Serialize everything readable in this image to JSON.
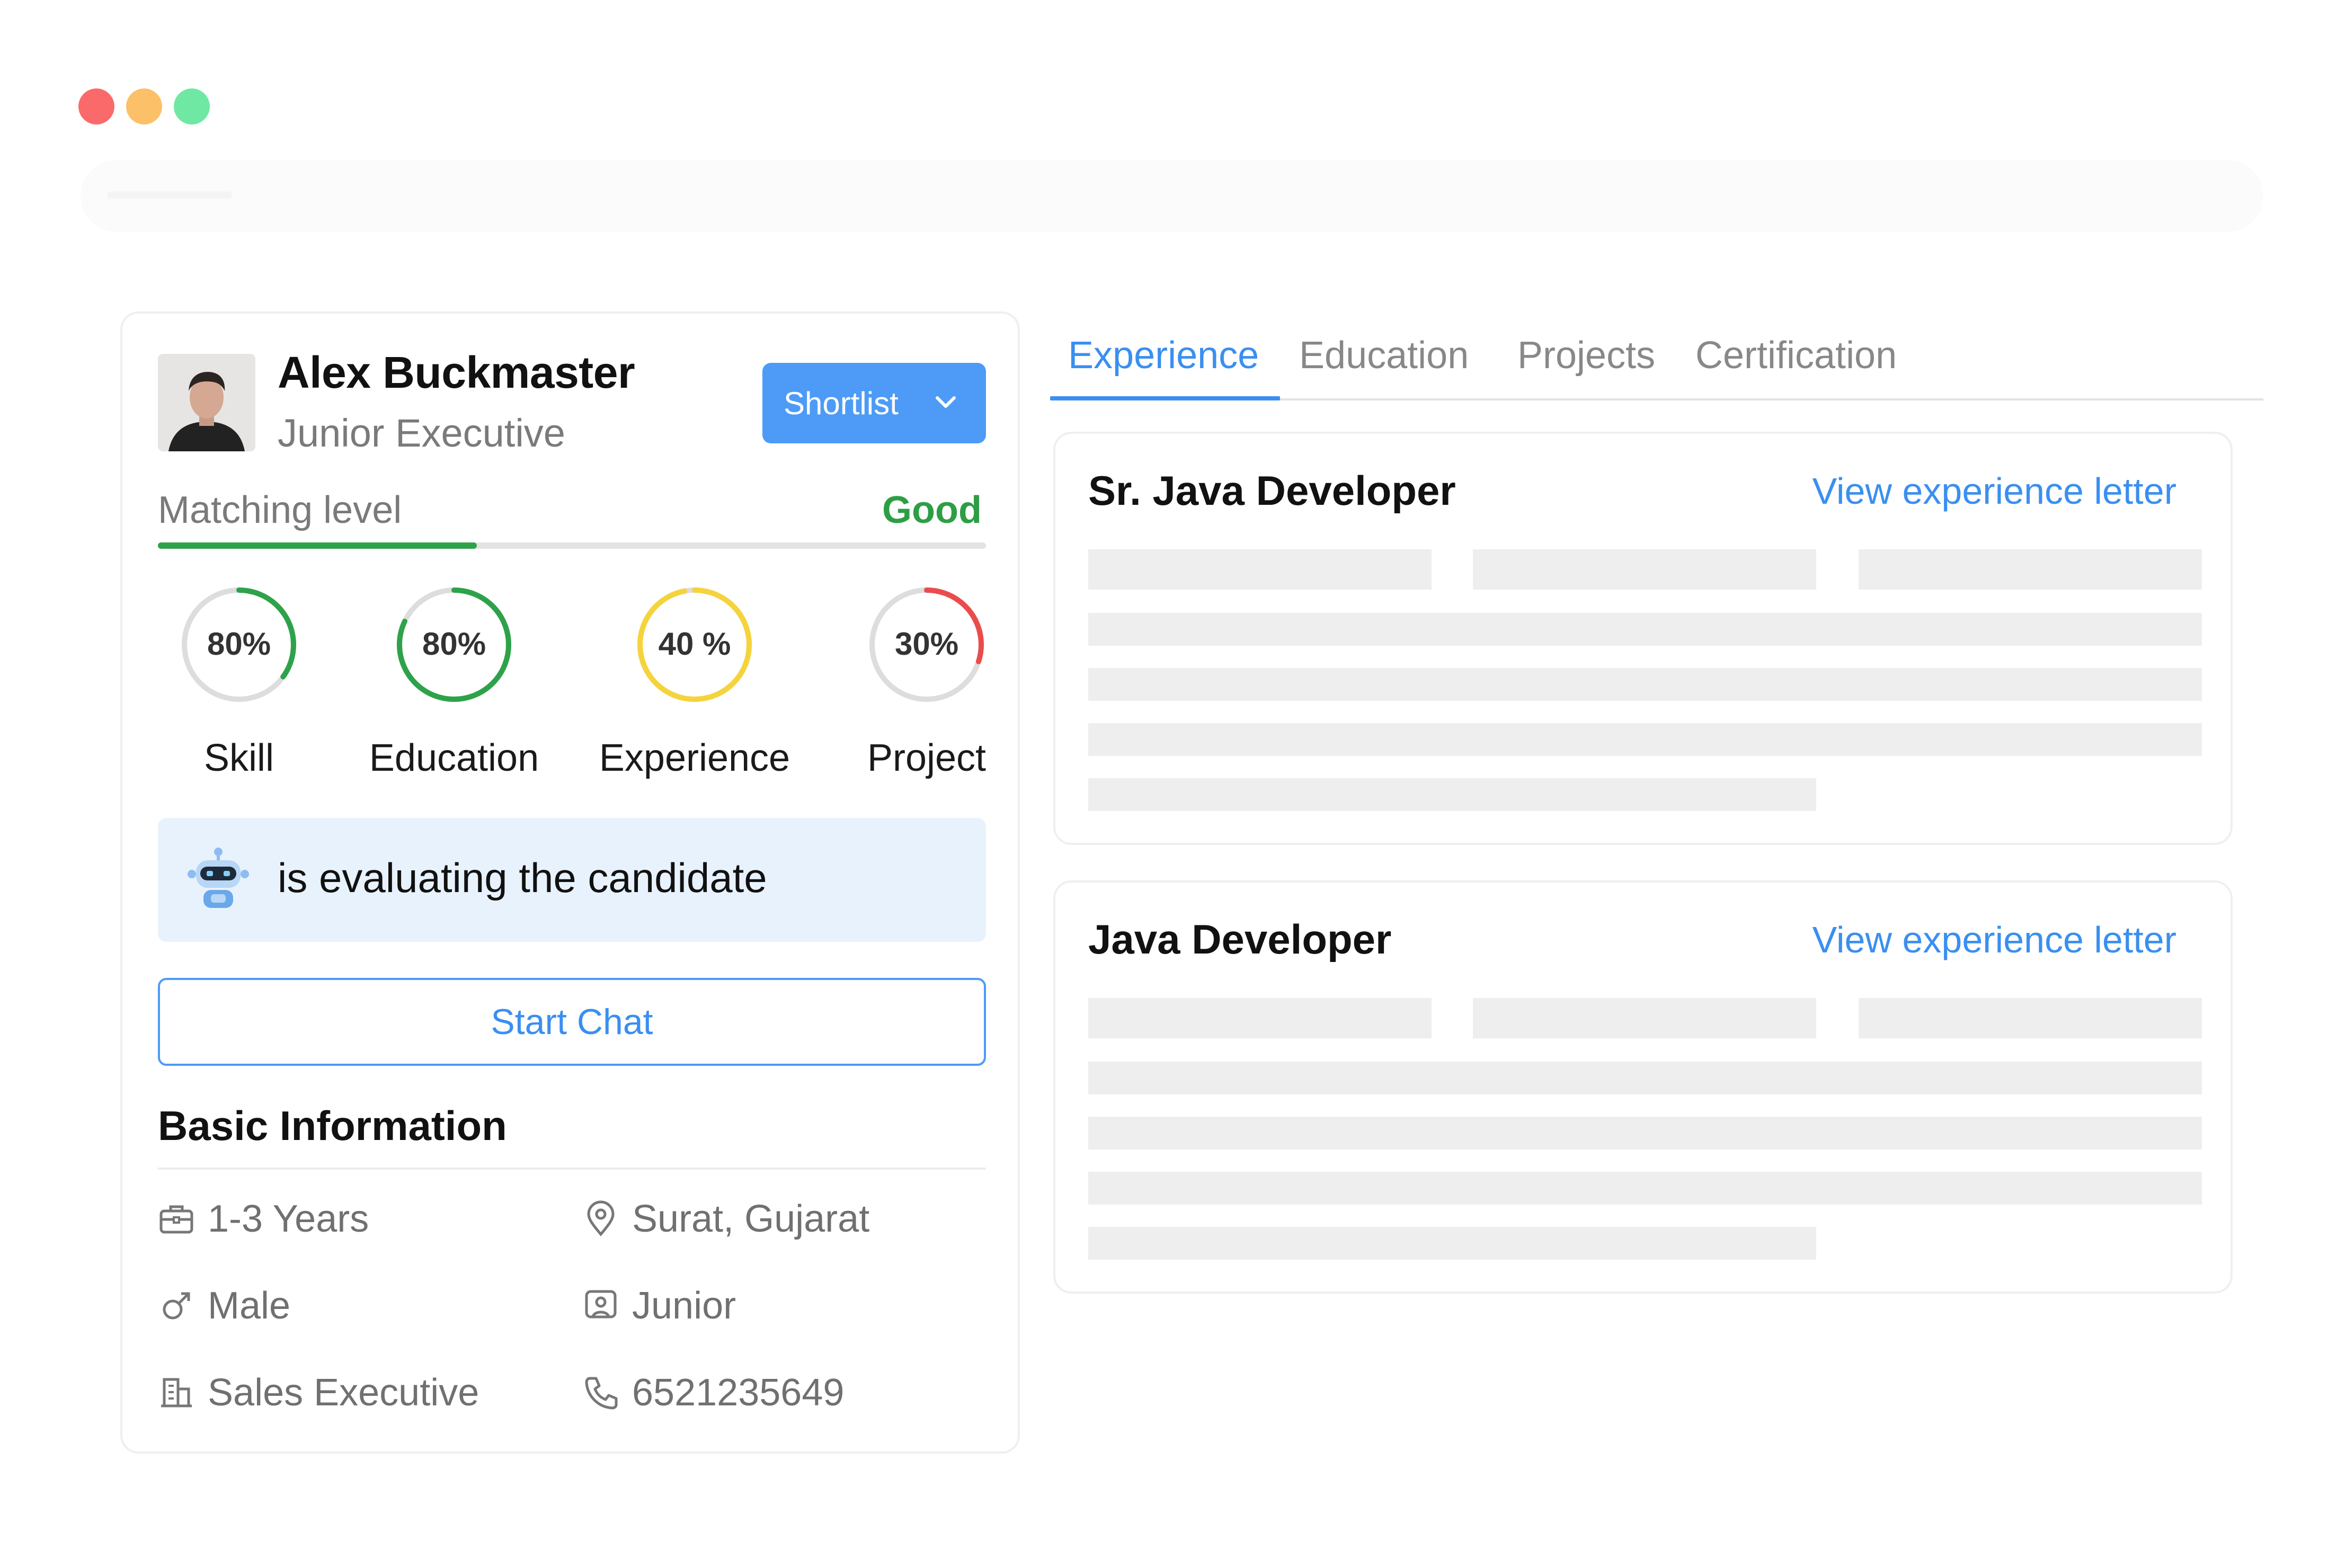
{
  "window": {
    "controls": [
      {
        "name": "close",
        "color": "#fa6a6a"
      },
      {
        "name": "minimize",
        "color": "#fcc068"
      },
      {
        "name": "maximize",
        "color": "#6fe8a4"
      }
    ]
  },
  "candidate": {
    "name": "Alex Buckmaster",
    "role": "Junior Executive",
    "action_button": "Shortlist"
  },
  "matching": {
    "label": "Matching level",
    "value_text": "Good",
    "level_fraction": 0.385,
    "color": "#2e9e45"
  },
  "scores": [
    {
      "label": "Skill",
      "value_text": "80%",
      "fraction": 0.35,
      "color": "#2ea24a"
    },
    {
      "label": "Education",
      "value_text": "80%",
      "fraction": 0.82,
      "color": "#2ea24a"
    },
    {
      "label": "Experience",
      "value_text": "40 %",
      "fraction": 0.97,
      "color": "#f5d33c"
    },
    {
      "label": "Project",
      "value_text": "30%",
      "fraction": 0.3,
      "color": "#ea4c4c"
    }
  ],
  "bot": {
    "icon": "robot-icon",
    "text": "is evaluating the candidate"
  },
  "start_chat": "Start Chat",
  "basic_info": {
    "title": "Basic Information",
    "experience": "1-3 Years",
    "location": "Surat, Gujarat",
    "gender": "Male",
    "level": "Junior",
    "department": "Sales Executive",
    "phone": "6521235649"
  },
  "tabs": [
    {
      "label": "Experience",
      "active": true
    },
    {
      "label": "Education",
      "active": false
    },
    {
      "label": "Projects",
      "active": false
    },
    {
      "label": "Certification",
      "active": false
    }
  ],
  "experiences": [
    {
      "title": "Sr. Java Developer",
      "link": "View experience letter"
    },
    {
      "title": "Java Developer",
      "link": "View experience letter"
    }
  ],
  "colors": {
    "accent": "#3a8ff0",
    "button": "#4d9bf7",
    "success": "#2e9e45",
    "skeleton": "#eeeeef"
  }
}
